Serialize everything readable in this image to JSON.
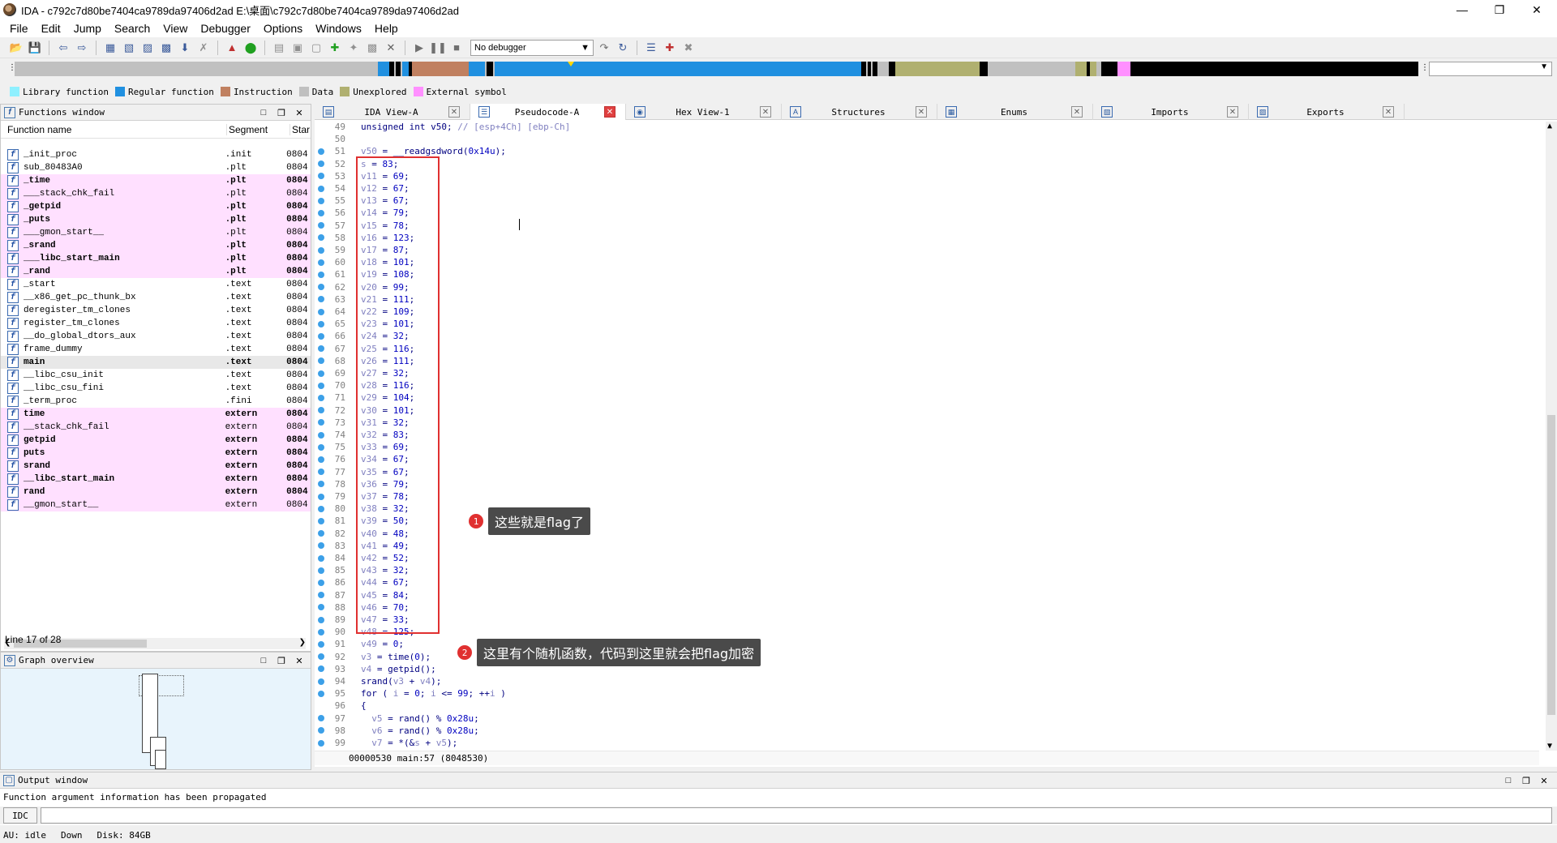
{
  "window": {
    "title": "IDA - c792c7d80be7404ca9789da97406d2ad E:\\桌面\\c792c7d80be7404ca9789da97406d2ad"
  },
  "menu": [
    "File",
    "Edit",
    "Jump",
    "Search",
    "View",
    "Debugger",
    "Options",
    "Windows",
    "Help"
  ],
  "toolbar": {
    "debugger_select": "No debugger"
  },
  "legend": [
    {
      "label": "Library function",
      "color": "#8ff0ff"
    },
    {
      "label": "Regular function",
      "color": "#2090e0"
    },
    {
      "label": "Instruction",
      "color": "#c08060"
    },
    {
      "label": "Data",
      "color": "#c0c0c0"
    },
    {
      "label": "Unexplored",
      "color": "#b0b070"
    },
    {
      "label": "External symbol",
      "color": "#ff90ff"
    }
  ],
  "functions_window": {
    "title": "Functions window",
    "columns": {
      "name": "Function name",
      "segment": "Segment",
      "start": "Star"
    },
    "rows": [
      {
        "name": "_init_proc",
        "segment": ".init",
        "start": "0804",
        "style": "normal"
      },
      {
        "name": "sub_80483A0",
        "segment": ".plt",
        "start": "0804",
        "style": "normal"
      },
      {
        "name": "_time",
        "segment": ".plt",
        "start": "0804",
        "style": "pinkbold"
      },
      {
        "name": "___stack_chk_fail",
        "segment": ".plt",
        "start": "0804",
        "style": "pink"
      },
      {
        "name": "_getpid",
        "segment": ".plt",
        "start": "0804",
        "style": "pinkbold"
      },
      {
        "name": "_puts",
        "segment": ".plt",
        "start": "0804",
        "style": "pinkbold"
      },
      {
        "name": "___gmon_start__",
        "segment": ".plt",
        "start": "0804",
        "style": "pink"
      },
      {
        "name": "_srand",
        "segment": ".plt",
        "start": "0804",
        "style": "pinkbold"
      },
      {
        "name": "___libc_start_main",
        "segment": ".plt",
        "start": "0804",
        "style": "pinkbold"
      },
      {
        "name": "_rand",
        "segment": ".plt",
        "start": "0804",
        "style": "pinkbold"
      },
      {
        "name": "_start",
        "segment": ".text",
        "start": "0804",
        "style": "normal"
      },
      {
        "name": "__x86_get_pc_thunk_bx",
        "segment": ".text",
        "start": "0804",
        "style": "normal"
      },
      {
        "name": "deregister_tm_clones",
        "segment": ".text",
        "start": "0804",
        "style": "normal"
      },
      {
        "name": "register_tm_clones",
        "segment": ".text",
        "start": "0804",
        "style": "normal"
      },
      {
        "name": "__do_global_dtors_aux",
        "segment": ".text",
        "start": "0804",
        "style": "normal"
      },
      {
        "name": "frame_dummy",
        "segment": ".text",
        "start": "0804",
        "style": "normal"
      },
      {
        "name": "main",
        "segment": ".text",
        "start": "0804",
        "style": "selected"
      },
      {
        "name": "__libc_csu_init",
        "segment": ".text",
        "start": "0804",
        "style": "normal"
      },
      {
        "name": "__libc_csu_fini",
        "segment": ".text",
        "start": "0804",
        "style": "normal"
      },
      {
        "name": "_term_proc",
        "segment": ".fini",
        "start": "0804",
        "style": "normal"
      },
      {
        "name": "time",
        "segment": "extern",
        "start": "0804",
        "style": "pinkbold"
      },
      {
        "name": "__stack_chk_fail",
        "segment": "extern",
        "start": "0804",
        "style": "pink"
      },
      {
        "name": "getpid",
        "segment": "extern",
        "start": "0804",
        "style": "pinkbold"
      },
      {
        "name": "puts",
        "segment": "extern",
        "start": "0804",
        "style": "pinkbold"
      },
      {
        "name": "srand",
        "segment": "extern",
        "start": "0804",
        "style": "pinkbold"
      },
      {
        "name": "__libc_start_main",
        "segment": "extern",
        "start": "0804",
        "style": "pinkbold"
      },
      {
        "name": "rand",
        "segment": "extern",
        "start": "0804",
        "style": "pinkbold"
      },
      {
        "name": "__gmon_start__",
        "segment": "extern",
        "start": "0804",
        "style": "pink"
      }
    ],
    "status": "Line 17 of 28"
  },
  "graph_overview": {
    "title": "Graph overview"
  },
  "tabs": [
    {
      "label": "IDA View-A",
      "active": false
    },
    {
      "label": "Pseudocode-A",
      "active": true
    },
    {
      "label": "Hex View-1",
      "active": false
    },
    {
      "label": "Structures",
      "active": false
    },
    {
      "label": "Enums",
      "active": false
    },
    {
      "label": "Imports",
      "active": false
    },
    {
      "label": "Exports",
      "active": false
    }
  ],
  "code": {
    "lines": [
      {
        "n": "49",
        "dot": false,
        "html": "unsigned int v50; <span class=\"cc\">// [esp+4Ch] [ebp-Ch]</span>"
      },
      {
        "n": "50",
        "dot": false,
        "html": ""
      },
      {
        "n": "51",
        "dot": true,
        "html": "<span class=\"cv\">v50</span> = __readgsdword(<span class=\"cn\">0x14u</span>);"
      },
      {
        "n": "52",
        "dot": true,
        "html": "<span class=\"cv\">s</span> = <span class=\"cn\">83</span>;"
      },
      {
        "n": "53",
        "dot": true,
        "html": "<span class=\"cv\">v11</span> = <span class=\"cn\">69</span>;"
      },
      {
        "n": "54",
        "dot": true,
        "html": "<span class=\"cv\">v12</span> = <span class=\"cn\">67</span>;"
      },
      {
        "n": "55",
        "dot": true,
        "html": "<span class=\"cv\">v13</span> = <span class=\"cn\">67</span>;"
      },
      {
        "n": "56",
        "dot": true,
        "html": "<span class=\"cv\">v14</span> = <span class=\"cn\">79</span>;"
      },
      {
        "n": "57",
        "dot": true,
        "html": "<span class=\"cv\">v15</span> = <span class=\"cn\">78</span>;"
      },
      {
        "n": "58",
        "dot": true,
        "html": "<span class=\"cv\">v16</span> = <span class=\"cn\">123</span>;"
      },
      {
        "n": "59",
        "dot": true,
        "html": "<span class=\"cv\">v17</span> = <span class=\"cn\">87</span>;"
      },
      {
        "n": "60",
        "dot": true,
        "html": "<span class=\"cv\">v18</span> = <span class=\"cn\">101</span>;"
      },
      {
        "n": "61",
        "dot": true,
        "html": "<span class=\"cv\">v19</span> = <span class=\"cn\">108</span>;"
      },
      {
        "n": "62",
        "dot": true,
        "html": "<span class=\"cv\">v20</span> = <span class=\"cn\">99</span>;"
      },
      {
        "n": "63",
        "dot": true,
        "html": "<span class=\"cv\">v21</span> = <span class=\"cn\">111</span>;"
      },
      {
        "n": "64",
        "dot": true,
        "html": "<span class=\"cv\">v22</span> = <span class=\"cn\">109</span>;"
      },
      {
        "n": "65",
        "dot": true,
        "html": "<span class=\"cv\">v23</span> = <span class=\"cn\">101</span>;"
      },
      {
        "n": "66",
        "dot": true,
        "html": "<span class=\"cv\">v24</span> = <span class=\"cn\">32</span>;"
      },
      {
        "n": "67",
        "dot": true,
        "html": "<span class=\"cv\">v25</span> = <span class=\"cn\">116</span>;"
      },
      {
        "n": "68",
        "dot": true,
        "html": "<span class=\"cv\">v26</span> = <span class=\"cn\">111</span>;"
      },
      {
        "n": "69",
        "dot": true,
        "html": "<span class=\"cv\">v27</span> = <span class=\"cn\">32</span>;"
      },
      {
        "n": "70",
        "dot": true,
        "html": "<span class=\"cv\">v28</span> = <span class=\"cn\">116</span>;"
      },
      {
        "n": "71",
        "dot": true,
        "html": "<span class=\"cv\">v29</span> = <span class=\"cn\">104</span>;"
      },
      {
        "n": "72",
        "dot": true,
        "html": "<span class=\"cv\">v30</span> = <span class=\"cn\">101</span>;"
      },
      {
        "n": "73",
        "dot": true,
        "html": "<span class=\"cv\">v31</span> = <span class=\"cn\">32</span>;"
      },
      {
        "n": "74",
        "dot": true,
        "html": "<span class=\"cv\">v32</span> = <span class=\"cn\">83</span>;"
      },
      {
        "n": "75",
        "dot": true,
        "html": "<span class=\"cv\">v33</span> = <span class=\"cn\">69</span>;"
      },
      {
        "n": "76",
        "dot": true,
        "html": "<span class=\"cv\">v34</span> = <span class=\"cn\">67</span>;"
      },
      {
        "n": "77",
        "dot": true,
        "html": "<span class=\"cv\">v35</span> = <span class=\"cn\">67</span>;"
      },
      {
        "n": "78",
        "dot": true,
        "html": "<span class=\"cv\">v36</span> = <span class=\"cn\">79</span>;"
      },
      {
        "n": "79",
        "dot": true,
        "html": "<span class=\"cv\">v37</span> = <span class=\"cn\">78</span>;"
      },
      {
        "n": "80",
        "dot": true,
        "html": "<span class=\"cv\">v38</span> = <span class=\"cn\">32</span>;"
      },
      {
        "n": "81",
        "dot": true,
        "html": "<span class=\"cv\">v39</span> = <span class=\"cn\">50</span>;"
      },
      {
        "n": "82",
        "dot": true,
        "html": "<span class=\"cv\">v40</span> = <span class=\"cn\">48</span>;"
      },
      {
        "n": "83",
        "dot": true,
        "html": "<span class=\"cv\">v41</span> = <span class=\"cn\">49</span>;"
      },
      {
        "n": "84",
        "dot": true,
        "html": "<span class=\"cv\">v42</span> = <span class=\"cn\">52</span>;"
      },
      {
        "n": "85",
        "dot": true,
        "html": "<span class=\"cv\">v43</span> = <span class=\"cn\">32</span>;"
      },
      {
        "n": "86",
        "dot": true,
        "html": "<span class=\"cv\">v44</span> = <span class=\"cn\">67</span>;"
      },
      {
        "n": "87",
        "dot": true,
        "html": "<span class=\"cv\">v45</span> = <span class=\"cn\">84</span>;"
      },
      {
        "n": "88",
        "dot": true,
        "html": "<span class=\"cv\">v46</span> = <span class=\"cn\">70</span>;"
      },
      {
        "n": "89",
        "dot": true,
        "html": "<span class=\"cv\">v47</span> = <span class=\"cn\">33</span>;"
      },
      {
        "n": "90",
        "dot": true,
        "html": "<span class=\"cv\">v48</span> = <span class=\"cn\">125</span>;"
      },
      {
        "n": "91",
        "dot": true,
        "html": "<span class=\"cv\">v49</span> = <span class=\"cn\">0</span>;"
      },
      {
        "n": "92",
        "dot": true,
        "html": "<span class=\"cv\">v3</span> = time(<span class=\"cn\">0</span>);"
      },
      {
        "n": "93",
        "dot": true,
        "html": "<span class=\"cv\">v4</span> = getpid();"
      },
      {
        "n": "94",
        "dot": true,
        "html": "srand(<span class=\"cv\">v3</span> + <span class=\"cv\">v4</span>);"
      },
      {
        "n": "95",
        "dot": true,
        "html": "for ( <span class=\"cv\">i</span> = <span class=\"cn\">0</span>; <span class=\"cv\">i</span> &lt;= <span class=\"cn\">99</span>; ++<span class=\"cv\">i</span> )"
      },
      {
        "n": "96",
        "dot": false,
        "html": "{"
      },
      {
        "n": "97",
        "dot": true,
        "html": "  <span class=\"cv\">v5</span> = rand() % <span class=\"cn\">0x28u</span>;"
      },
      {
        "n": "98",
        "dot": true,
        "html": "  <span class=\"cv\">v6</span> = rand() % <span class=\"cn\">0x28u</span>;"
      },
      {
        "n": "99",
        "dot": true,
        "html": "  <span class=\"cv\">v7</span> = *(&amp;<span class=\"cv\">s</span> + <span class=\"cv\">v5</span>);"
      }
    ],
    "status": "00000530 main:57 (8048530)"
  },
  "annotations": [
    {
      "num": "1",
      "text": "这些就是flag了"
    },
    {
      "num": "2",
      "text": "这里有个随机函数，代码到这里就会把flag加密"
    }
  ],
  "output_window": {
    "title": "Output window",
    "text": "Function argument information has been propagated",
    "idc_label": "IDC"
  },
  "statusbar": {
    "au": "AU:  idle",
    "down": "Down",
    "disk": "Disk: 84GB"
  }
}
